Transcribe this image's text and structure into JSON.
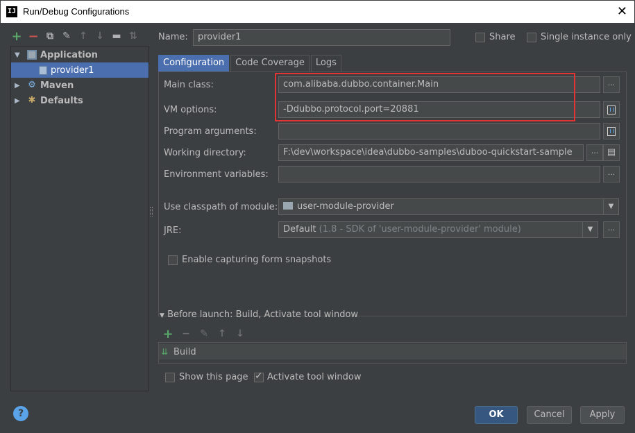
{
  "window": {
    "title": "Run/Debug Configurations",
    "app_icon_text": "IJ",
    "close_symbol": "✕"
  },
  "tree_toolbar": {
    "icons": [
      "add-icon",
      "remove-icon",
      "copy-icon",
      "wrench-icon",
      "move-up-icon",
      "move-down-icon",
      "folder-icon",
      "sort-icon"
    ]
  },
  "tree": {
    "items": [
      {
        "label": "Application",
        "expanded": true,
        "icon": "application-icon"
      },
      {
        "label": "provider1",
        "selected": true,
        "icon": "config-file-icon"
      },
      {
        "label": "Maven",
        "expanded": false,
        "icon": "maven-icon"
      },
      {
        "label": "Defaults",
        "expanded": false,
        "icon": "defaults-icon"
      }
    ]
  },
  "header": {
    "name_label": "Name:",
    "name_value": "provider1",
    "share_label": "Share",
    "share_checked": false,
    "single_instance_label": "Single instance only",
    "single_instance_checked": false
  },
  "tabs": [
    {
      "label": "Configuration",
      "active": true
    },
    {
      "label": "Code Coverage",
      "active": false
    },
    {
      "label": "Logs",
      "active": false
    }
  ],
  "config": {
    "main_class_label": "Main class:",
    "main_class_value": "com.alibaba.dubbo.container.Main",
    "vm_options_label": "VM options:",
    "vm_options_value": "-Ddubbo.protocol.port=20881",
    "program_args_label": "Program arguments:",
    "program_args_value": "",
    "working_dir_label": "Working directory:",
    "working_dir_value": "F:\\dev\\workspace\\idea\\dubbo-samples\\duboo-quickstart-sample",
    "env_vars_label": "Environment variables:",
    "env_vars_value": "",
    "classpath_label": "Use classpath of module:",
    "classpath_value": "user-module-provider",
    "jre_label": "JRE:",
    "jre_value": "Default",
    "jre_detail": "(1.8 - SDK of 'user-module-provider' module)",
    "snapshots_label": "Enable capturing form snapshots",
    "snapshots_checked": false,
    "dots": "..."
  },
  "before_launch": {
    "label": "Before launch: Build, Activate tool window",
    "items": [
      {
        "label": "Build",
        "icon": "build-icon"
      }
    ],
    "show_page_label": "Show this page",
    "show_page_checked": false,
    "activate_label": "Activate tool window",
    "activate_checked": true
  },
  "buttons": {
    "help": "?",
    "ok": "OK",
    "cancel": "Cancel",
    "apply": "Apply"
  },
  "colors": {
    "background": "#3c3f41",
    "selection": "#4b6eaf",
    "highlight_box": "#e53333",
    "ok_button": "#365880"
  }
}
